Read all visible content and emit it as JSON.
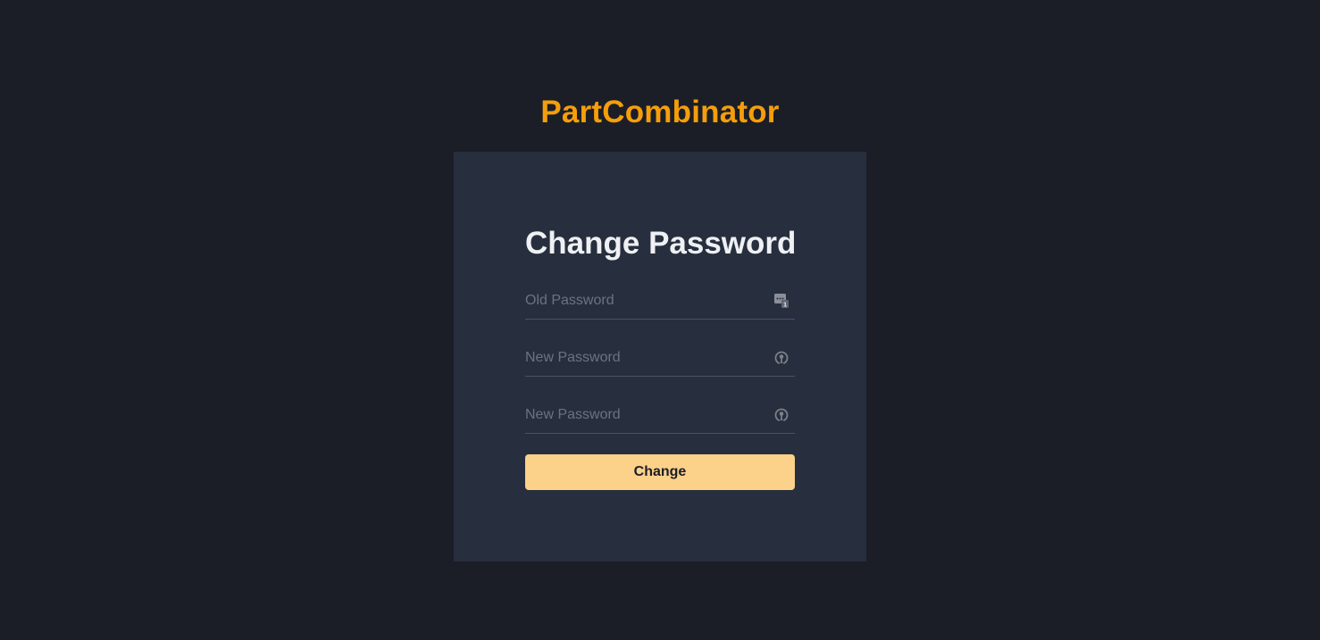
{
  "app": {
    "title": "PartCombinator"
  },
  "form": {
    "title": "Change Password",
    "fields": [
      {
        "placeholder": "Old Password",
        "value": "",
        "icon": "password-manager-icon"
      },
      {
        "placeholder": "New Password",
        "value": "",
        "icon": "key-autofill-icon"
      },
      {
        "placeholder": "New Password",
        "value": "",
        "icon": "key-autofill-icon"
      }
    ],
    "submit_label": "Change"
  },
  "colors": {
    "background": "#1b1e27",
    "card": "#272f3e",
    "brand": "#f59e0b",
    "button": "#fcd18a",
    "field_border": "#4b5363",
    "placeholder": "#6b7280"
  }
}
